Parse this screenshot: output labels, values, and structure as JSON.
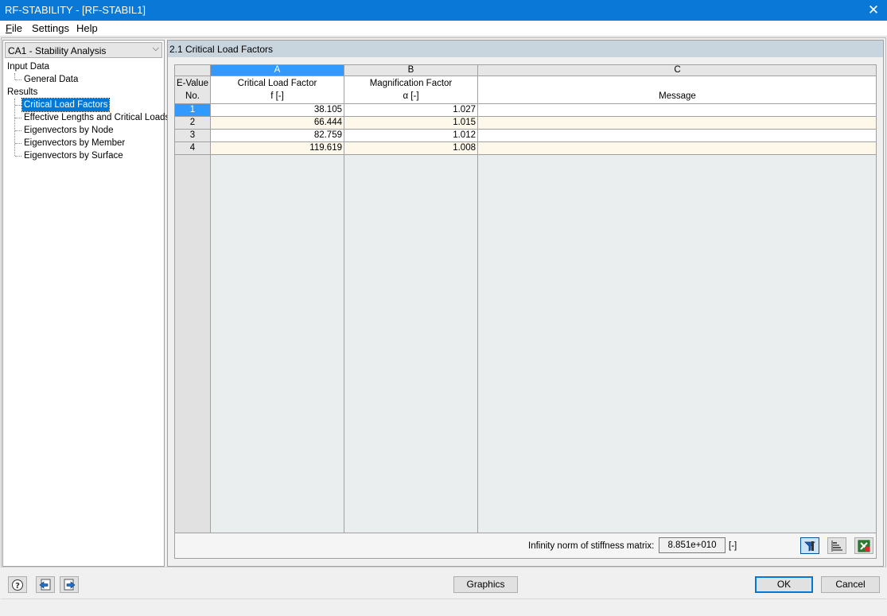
{
  "window": {
    "title": "RF-STABILITY - [RF-STABIL1]"
  },
  "menu": [
    {
      "label": "File",
      "underline": "F",
      "rest": "ile"
    },
    {
      "label": "Settings"
    },
    {
      "label": "Help"
    }
  ],
  "nav": {
    "case_select": "CA1 - Stability Analysis",
    "groups": [
      {
        "label": "Input Data",
        "items": [
          "General Data"
        ]
      },
      {
        "label": "Results",
        "items": [
          "Critical Load Factors",
          "Effective Lengths and Critical Loads",
          "Eigenvectors by Node",
          "Eigenvectors by Member",
          "Eigenvectors by Surface"
        ]
      }
    ],
    "selected": "Critical Load Factors"
  },
  "section": {
    "title": "2.1 Critical Load Factors"
  },
  "table": {
    "col_letters": [
      "A",
      "B",
      "C"
    ],
    "rownum_header": [
      "E-Value",
      "No."
    ],
    "col_headers": [
      [
        "Critical Load Factor",
        "f [-]"
      ],
      [
        "Magnification Factor",
        "α [-]"
      ],
      [
        "",
        "Message"
      ]
    ],
    "rows": [
      {
        "no": "1",
        "f": "38.105",
        "alpha": "1.027",
        "msg": ""
      },
      {
        "no": "2",
        "f": "66.444",
        "alpha": "1.015",
        "msg": ""
      },
      {
        "no": "3",
        "f": "82.759",
        "alpha": "1.012",
        "msg": ""
      },
      {
        "no": "4",
        "f": "119.619",
        "alpha": "1.008",
        "msg": ""
      }
    ]
  },
  "footer": {
    "norm_label": "Infinity norm of stiffness matrix:",
    "norm_value": "8.851e+010",
    "norm_unit": "[-]"
  },
  "buttons": {
    "graphics": "Graphics",
    "ok": "OK",
    "cancel": "Cancel"
  },
  "icons": [
    "help-icon",
    "previous-icon",
    "next-icon",
    "filter-icon",
    "bar-chart-icon",
    "excel-export-icon",
    "close-icon",
    "dropdown-icon"
  ]
}
